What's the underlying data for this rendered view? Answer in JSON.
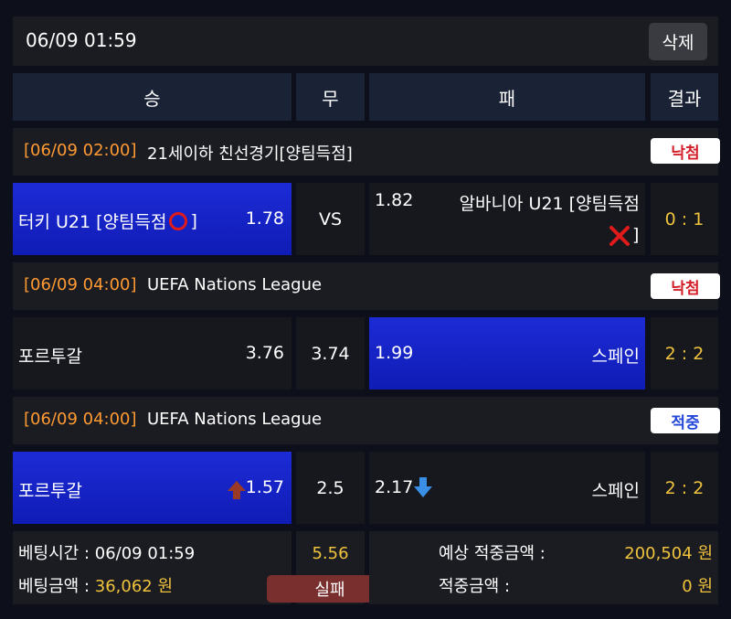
{
  "header": {
    "datetime": "06/09 01:59",
    "delete_label": "삭제"
  },
  "columns": {
    "win": "승",
    "draw": "무",
    "lose": "패",
    "result": "결과"
  },
  "games": [
    {
      "info_time": "[06/09 02:00]",
      "league": "21세이하 친선경기[양팀득점]",
      "status": "낙첨",
      "home": "터키 U21 [양팀득점",
      "home_suffix": "]",
      "home_odds": "1.78",
      "draw": "VS",
      "away_odds": "1.82",
      "away": "알바니아 U21 [양팀득점",
      "away_suffix": "]",
      "score": "0 : 1"
    },
    {
      "info_time": "[06/09 04:00]",
      "league": "UEFA Nations League",
      "status": "낙첨",
      "home": "포르투갈",
      "home_odds": "3.76",
      "draw": "3.74",
      "away_odds": "1.99",
      "away": "스페인",
      "score": "2 : 2"
    },
    {
      "info_time": "[06/09 04:00]",
      "league": "UEFA Nations League",
      "status": "적중",
      "home": "포르투갈",
      "home_odds": "1.57",
      "draw": "2.5",
      "away_odds": "2.17",
      "away": "스페인",
      "score": "2 : 2"
    }
  ],
  "summary": {
    "bet_time_label": "베팅시간 : 06/09 01:59",
    "bet_amount_label": "베팅금액 :",
    "bet_amount": "36,062 원",
    "total_odds": "5.56",
    "result": "실패",
    "expected_label": "예상 적중금액 :",
    "expected_amount": "200,504 원",
    "win_label": "적중금액 :",
    "win_amount": "0 원"
  },
  "colors": {
    "selected_blue": "#1a28cf",
    "gold": "#f0c33c",
    "orange": "#ff9a33",
    "lose_red": "#d3202a",
    "win_blue": "#2146d8",
    "result_button": "#7a2a2a"
  },
  "icons": [
    "circle-mark-icon",
    "x-mark-icon",
    "up-arrow-icon",
    "down-arrow-icon"
  ]
}
